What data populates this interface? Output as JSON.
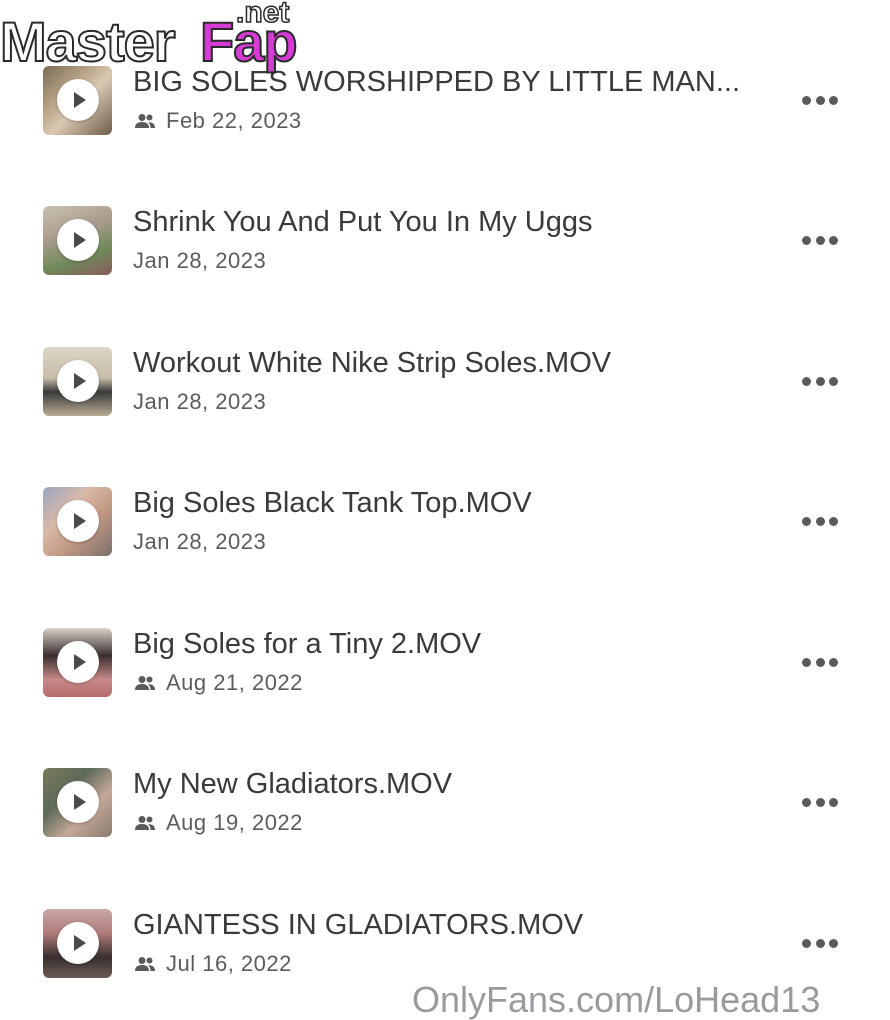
{
  "watermark": {
    "part1": "Master",
    "part2": "Fap",
    "part3": ".net"
  },
  "colors": {
    "text": "#3a3a3c",
    "date": "#5c5c5f",
    "icon": "#5a5a5d",
    "watermark_accent": "#d63bd6"
  },
  "videos": [
    {
      "title": "BIG SOLES WORSHIPPED BY LITTLE MAN...",
      "date": "Feb 22, 2023",
      "shared_icon": "people-icon"
    },
    {
      "title": "Shrink You And Put You In My Uggs",
      "date": "Jan 28, 2023",
      "shared_icon": null
    },
    {
      "title": "Workout White Nike Strip Soles.MOV",
      "date": "Jan 28, 2023",
      "shared_icon": null
    },
    {
      "title": "Big Soles Black Tank Top.MOV",
      "date": "Jan 28, 2023",
      "shared_icon": null
    },
    {
      "title": "Big Soles for a Tiny 2.MOV",
      "date": "Aug 21, 2022",
      "shared_icon": "people-icon"
    },
    {
      "title": "My New Gladiators.MOV",
      "date": "Aug 19, 2022",
      "shared_icon": "people-icon"
    },
    {
      "title": "GIANTESS IN GLADIATORS.MOV",
      "date": "Jul 16, 2022",
      "shared_icon": "people-icon"
    }
  ],
  "footer_partial_text": "OnlyFans.com/LoHead13"
}
